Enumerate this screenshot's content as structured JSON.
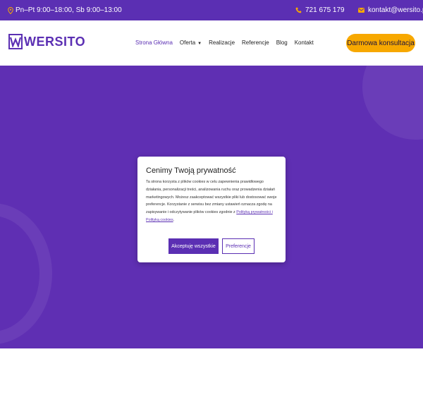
{
  "topbar": {
    "hours": "Pn–Pt 9:00–18:00, Sb 9:00–13:00",
    "phone": "721 675 179",
    "email": "kontakt@wersito.pl"
  },
  "header": {
    "logo_text": "WERSITO",
    "nav": {
      "home": "Strona Główna",
      "offer": "Oferta",
      "projects": "Realizacje",
      "references": "Referencje",
      "blog": "Blog",
      "contact": "Kontakt"
    },
    "cta": "Darmowa konsultacja"
  },
  "cookie": {
    "title": "Cenimy Twoją prywatność",
    "body": "Ta strona korzysta z plików cookies w celu zapewnienia prawidłowego działania, personalizacji treści, analizowania ruchu oraz prowadzenia działań marketingowych. Możesz zaakceptować wszystkie pliki lub dostosować swoje preferencje. Korzystanie z serwisu bez zmiany ustawień oznacza zgodę na zapisywanie i odczytywanie plików cookies zgodnie z",
    "link": "Polityką prywatności i Polityką cookies",
    "body_end": ".",
    "accept": "Akceptuję wszystkie",
    "preferences": "Preferencje"
  },
  "colors": {
    "brand": "#5b2fb3",
    "cta": "#f7a800"
  },
  "icons": [
    "location-icon",
    "phone-icon",
    "mail-icon",
    "logo-w-icon",
    "chevron-down-icon"
  ]
}
